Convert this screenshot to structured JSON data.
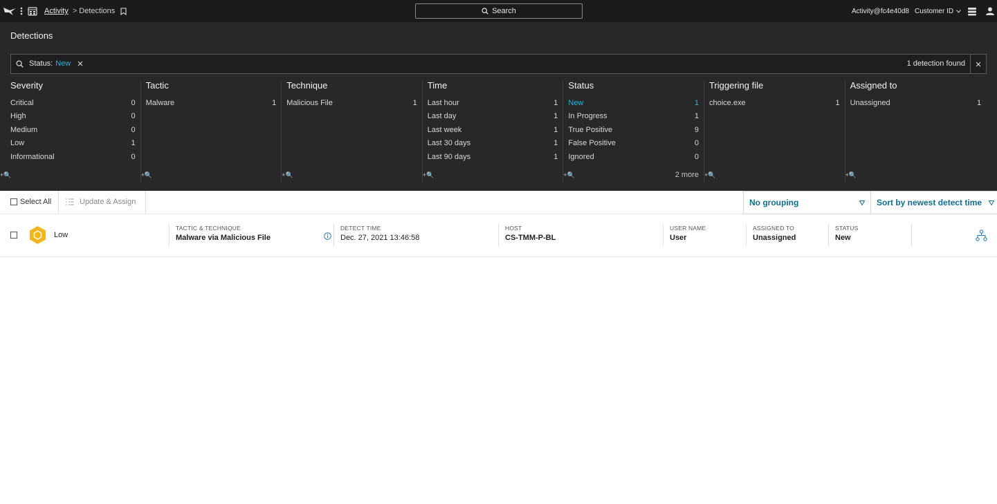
{
  "topbar": {
    "breadcrumb_root": "Activity",
    "breadcrumb_separator": ">",
    "breadcrumb_current": "Detections",
    "search_label": "Search",
    "user": "Activity@fc4e40d8",
    "customer_id": "Customer ID"
  },
  "panel": {
    "title": "Detections",
    "filter_label": "Status:",
    "filter_value": "New",
    "found_count": "1 detection found"
  },
  "facets": [
    {
      "title": "Severity",
      "rows": [
        {
          "label": "Critical",
          "count": "0"
        },
        {
          "label": "High",
          "count": "0"
        },
        {
          "label": "Medium",
          "count": "0"
        },
        {
          "label": "Low",
          "count": "1"
        },
        {
          "label": "Informational",
          "count": "0"
        }
      ],
      "more": ""
    },
    {
      "title": "Tactic",
      "rows": [
        {
          "label": "Malware",
          "count": "1"
        }
      ],
      "more": ""
    },
    {
      "title": "Technique",
      "rows": [
        {
          "label": "Malicious File",
          "count": "1"
        }
      ],
      "more": ""
    },
    {
      "title": "Time",
      "rows": [
        {
          "label": "Last hour",
          "count": "1"
        },
        {
          "label": "Last day",
          "count": "1"
        },
        {
          "label": "Last week",
          "count": "1"
        },
        {
          "label": "Last 30 days",
          "count": "1"
        },
        {
          "label": "Last 90 days",
          "count": "1"
        }
      ],
      "more": ""
    },
    {
      "title": "Status",
      "rows": [
        {
          "label": "New",
          "count": "1",
          "active": true
        },
        {
          "label": "In Progress",
          "count": "1"
        },
        {
          "label": "True Positive",
          "count": "9"
        },
        {
          "label": "False Positive",
          "count": "0"
        },
        {
          "label": "Ignored",
          "count": "0"
        }
      ],
      "more": "2 more"
    },
    {
      "title": "Triggering file",
      "rows": [
        {
          "label": "choice.exe",
          "count": "1"
        }
      ],
      "more": ""
    },
    {
      "title": "Assigned to",
      "rows": [
        {
          "label": "Unassigned",
          "count": "1"
        }
      ],
      "more": ""
    }
  ],
  "facet_add_label": "+🔍",
  "toolbar": {
    "select_all": "Select All",
    "update_assign": "Update & Assign",
    "grouping": "No grouping",
    "sort": "Sort by newest detect time"
  },
  "detection": {
    "severity": "Low",
    "tactic_label": "TACTIC & TECHNIQUE",
    "tactic_value": "Malware via Malicious File",
    "time_label": "DETECT TIME",
    "time_value": "Dec. 27, 2021 13:46:58",
    "host_label": "HOST",
    "host_value": "CS-TMM-P-BL",
    "user_label": "USER NAME",
    "user_value": "User",
    "assigned_label": "ASSIGNED TO",
    "assigned_value": "Unassigned",
    "status_label": "STATUS",
    "status_value": "New"
  },
  "colors": {
    "accent": "#2fb2d8",
    "link": "#0f6e8e",
    "severity_low": "#f2b51c",
    "panel_bg": "#28282b",
    "topbar_bg": "#1b1b1d"
  },
  "icons": [
    "falcon-logo-icon",
    "kebab-menu-icon",
    "app-grid-icon",
    "bookmark-icon",
    "search-icon",
    "chevron-down-icon",
    "notes-icon",
    "user-icon",
    "close-icon",
    "list-icon",
    "funnel-icon",
    "hexagon-low-icon",
    "info-icon",
    "process-tree-icon"
  ]
}
